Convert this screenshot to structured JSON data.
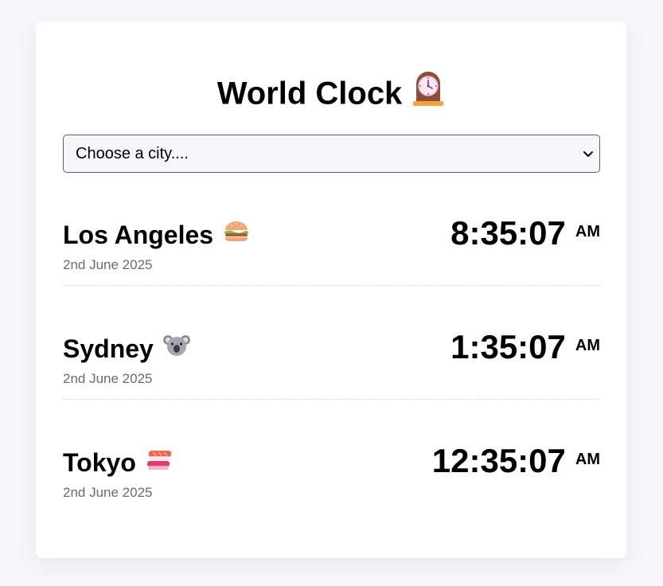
{
  "header": {
    "title": "World Clock",
    "title_icon": "mantelpiece-clock-icon"
  },
  "city_select": {
    "placeholder": "Choose a city...."
  },
  "cities": [
    {
      "name": "Los Angeles",
      "icon": "hamburger-icon",
      "date": "2nd June 2025",
      "time": "8:35:07",
      "ampm": "AM"
    },
    {
      "name": "Sydney",
      "icon": "koala-icon",
      "date": "2nd June 2025",
      "time": "1:35:07",
      "ampm": "AM"
    },
    {
      "name": "Tokyo",
      "icon": "sushi-icon",
      "date": "2nd June 2025",
      "time": "12:35:07",
      "ampm": "AM"
    }
  ],
  "colors": {
    "page_background": "#f7f6fb",
    "card_background": "#ffffff",
    "date_text": "#6b6b6b",
    "divider": "#d9d9d9"
  }
}
